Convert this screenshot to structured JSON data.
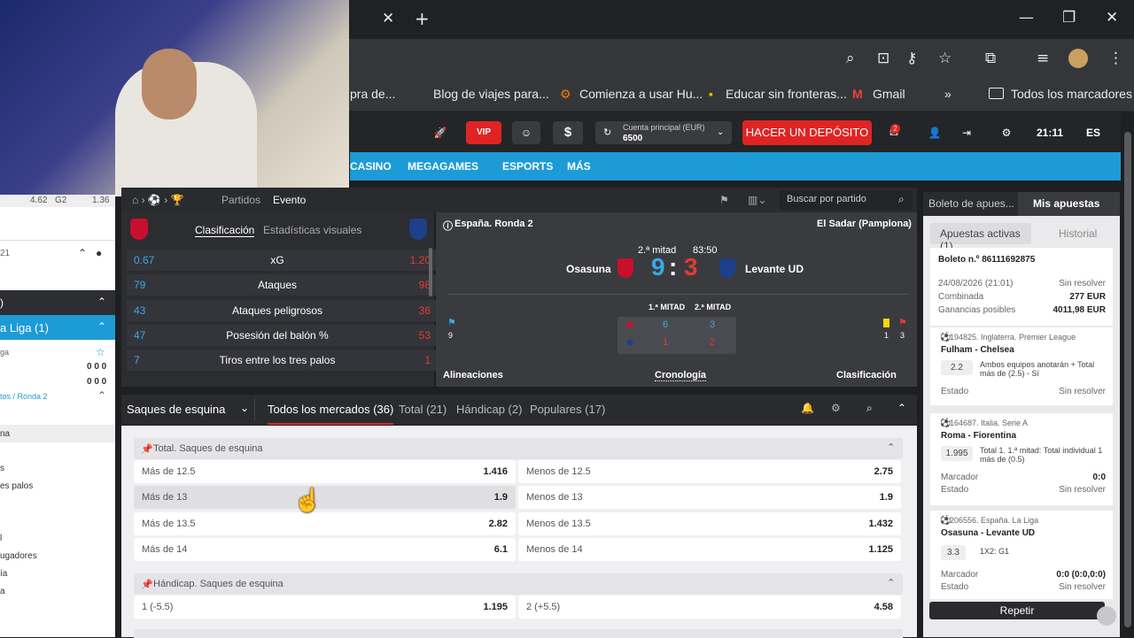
{
  "browser": {
    "bookmarks": [
      "pra de...",
      "Blog de viajes para...",
      "Comienza a usar Hu...",
      "Educar sin fronteras...",
      "Gmail",
      "Todos los marcadores"
    ]
  },
  "site": {
    "header": {
      "vip": "VIP",
      "account_label": "Cuenta principal (EUR)",
      "account_value": "6500",
      "deposit": "HACER UN DEPÓSITO",
      "time": "21:11",
      "lang": "ES",
      "mail_badge": "2"
    },
    "nav": [
      "CASINO",
      "MEGAGAMES",
      "ESPORTS",
      "MÁS"
    ]
  },
  "event": {
    "breadcrumb_partidos": "Partidos",
    "breadcrumb_evento": "Evento",
    "search_placeholder": "Buscar por partido",
    "tabs": [
      "Clasificación",
      "Estadísticas visuales"
    ],
    "stats": [
      {
        "l": "0.67",
        "name": "xG",
        "r": "1.20"
      },
      {
        "l": "79",
        "name": "Ataques",
        "r": "98"
      },
      {
        "l": "43",
        "name": "Ataques peligrosos",
        "r": "36"
      },
      {
        "l": "47",
        "name": "Posesión del balón %",
        "r": "53"
      },
      {
        "l": "7",
        "name": "Tiros entre los tres palos",
        "r": "1"
      }
    ],
    "round": "España. Ronda 2",
    "stadium": "El Sadar (Pamplona)",
    "half": "2.ª mitad",
    "clock": "83:50",
    "home": "Osasuna",
    "away": "Levante UD",
    "home_score": "9",
    "away_score": "3",
    "h1": "1.ª MITAD",
    "h2": "2.ª MITAD",
    "home_h1": "6",
    "home_h2": "3",
    "away_h1": "1",
    "away_h2": "2",
    "home_corners": "9",
    "away_yellow": "1",
    "away_corners": "3",
    "alineaciones": "Alineaciones",
    "cronologia": "Cronología",
    "clasificacion": "Clasificación"
  },
  "markets": {
    "selector": "Saques de esquina",
    "tabs": [
      "Todos los mercados (36)",
      "Total (21)",
      "Hándicap (2)",
      "Populares (17)"
    ],
    "section1": "Total. Saques de esquina",
    "rows": [
      {
        "a": "Más de 12.5",
        "av": "1.416",
        "b": "Menos de 12.5",
        "bv": "2.75"
      },
      {
        "a": "Más de 13",
        "av": "1.9",
        "b": "Menos de 13",
        "bv": "1.9"
      },
      {
        "a": "Más de 13.5",
        "av": "2.82",
        "b": "Menos de 13.5",
        "bv": "1.432"
      },
      {
        "a": "Más de 14",
        "av": "6.1",
        "b": "Menos de 14",
        "bv": "1.125"
      }
    ],
    "section2": "Hándicap. Saques de esquina",
    "hrow": {
      "a": "1 (-5.5)",
      "av": "1.195",
      "b": "2 (+5.5)",
      "bv": "4.58"
    }
  },
  "left": {
    "top_vals": [
      "4.62",
      "G2",
      "1.36"
    ],
    "liga": "a Liga (1)",
    "items": [
      "ga",
      "0 0 0",
      "0 0 0",
      "tos / Ronda 2",
      "na",
      "s",
      "es palos",
      "l",
      "ugadores",
      "ía",
      "a",
      "21",
      ")"
    ]
  },
  "betslip": {
    "tab1": "Boleto de apues...",
    "tab2": "Mis apuestas",
    "active": "Apuestas activas (1)",
    "history": "Historial",
    "boleto": "Boleto n.º 86111692875",
    "date": "24/08/2026 (21:01)",
    "status": "Sin resolver",
    "type": "Combinada",
    "stake": "277 EUR",
    "gains_label": "Ganancias posibles",
    "gains": "4011,98 EUR",
    "bets": [
      {
        "league": "194825. Inglaterra. Premier League",
        "match": "Fulham - Chelsea",
        "odd": "2.2",
        "desc": "Ambos equipos anotarán + Total más de (2.5) - Sí",
        "k1": "Estado",
        "v1": "Sin resolver"
      },
      {
        "league": "164687. Italia. Serie A",
        "match": "Roma - Fiorentina",
        "odd": "1.995",
        "desc": "Total 1. 1.ª mitad: Total individual 1 más de (0.5)",
        "k0": "Marcador",
        "v0": "0:0",
        "k1": "Estado",
        "v1": "Sin resolver"
      },
      {
        "league": "206556. España. La Liga",
        "match": "Osasuna - Levante UD",
        "odd": "3.3",
        "desc": "1X2: G1",
        "k0": "Marcador",
        "v0": "0:0 (0:0,0:0)",
        "k1": "Estado",
        "v1": "Sin resolver"
      }
    ],
    "repeat": "Repetir"
  }
}
